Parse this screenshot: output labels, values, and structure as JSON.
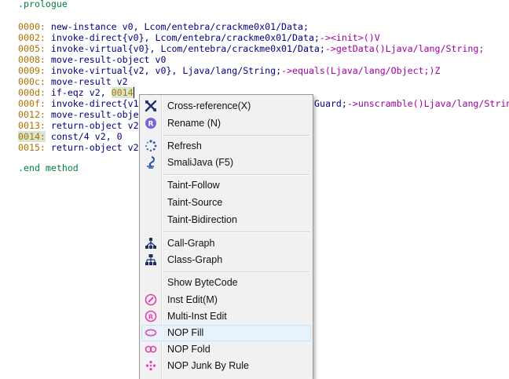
{
  "code": {
    "header": ".prologue",
    "lines": [
      {
        "offset": "0000:",
        "instr": "new-instance v0, Lcom/entebra/crackme0x01/Data;"
      },
      {
        "offset": "0002:",
        "instr": "invoke-direct{v0}, Lcom/entebra/crackme0x01/Data;",
        "call": "-><init>()V"
      },
      {
        "offset": "0005:",
        "instr": "invoke-virtual{v0}, Lcom/entebra/crackme0x01/Data;",
        "call": "->getData()Ljava/lang/String;"
      },
      {
        "offset": "0008:",
        "instr": "move-result-object v0"
      },
      {
        "offset": "0009:",
        "instr": "invoke-virtual{v2, v0}, Ljava/lang/String;",
        "call": "->equals(Ljava/lang/Object;)Z"
      },
      {
        "offset": "000c:",
        "instr": "move-result v2"
      },
      {
        "offset": "000d:",
        "instr": "if-eqz v2,",
        "target": "0014"
      },
      {
        "offset": "000f:",
        "instr": "invoke-direct{v1",
        "tail": "Guard;",
        "call": "->unscramble()Ljava/lang/Strin"
      },
      {
        "offset": "0012:",
        "instr": "move-result-obje"
      },
      {
        "offset": "0013:",
        "instr": "return-object v2"
      },
      {
        "offset": "0014:",
        "instr": "const/4 v2, 0"
      },
      {
        "offset": "0015:",
        "instr": "return-object v2"
      }
    ],
    "footer": ".end method"
  },
  "colors": {
    "offset": "#b07000",
    "instruction": "#000080",
    "call": "#a000a0",
    "keyword": "#008040",
    "menu_bg": "#f1f1f1",
    "menu_hover": "#e8f2fb",
    "icon_blue": "#3050c0",
    "icon_magenta": "#e040b0"
  },
  "context_menu": {
    "items": [
      {
        "label": "Cross-reference(X)",
        "icon": "cross-reference-icon"
      },
      {
        "label": "Rename (N)",
        "icon": "rename-icon"
      },
      {
        "label": "Refresh",
        "icon": "refresh-icon"
      },
      {
        "label": "SmaliJava (F5)",
        "icon": "smali-java-icon"
      },
      {
        "label": "Taint-Follow",
        "icon": ""
      },
      {
        "label": "Taint-Source",
        "icon": ""
      },
      {
        "label": "Taint-Bidirection",
        "icon": ""
      },
      {
        "label": "Call-Graph",
        "icon": "call-graph-icon"
      },
      {
        "label": "Class-Graph",
        "icon": "class-graph-icon"
      },
      {
        "label": "Show ByteCode",
        "icon": ""
      },
      {
        "label": "Inst Edit(M)",
        "icon": "inst-edit-icon"
      },
      {
        "label": "Multi-Inst Edit",
        "icon": "multi-inst-edit-icon"
      },
      {
        "label": "NOP Fill",
        "icon": "nop-fill-icon",
        "highlighted": true
      },
      {
        "label": "NOP Fold",
        "icon": "nop-fold-icon"
      },
      {
        "label": "NOP Junk By Rule",
        "icon": "nop-junk-icon"
      }
    ]
  }
}
